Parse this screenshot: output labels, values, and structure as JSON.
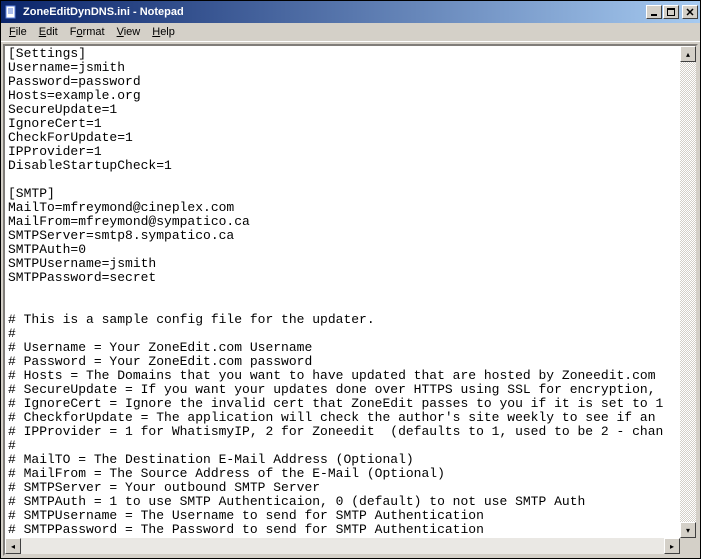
{
  "title": "ZoneEditDynDNS.ini - Notepad",
  "menu": {
    "file": "File",
    "edit": "Edit",
    "format": "Format",
    "view": "View",
    "help": "Help"
  },
  "content": "[Settings]\nUsername=jsmith\nPassword=password\nHosts=example.org\nSecureUpdate=1\nIgnoreCert=1\nCheckForUpdate=1\nIPProvider=1\nDisableStartupCheck=1\n\n[SMTP]\nMailTo=mfreymond@cineplex.com\nMailFrom=mfreymond@sympatico.ca\nSMTPServer=smtp8.sympatico.ca\nSMTPAuth=0\nSMTPUsername=jsmith\nSMTPPassword=secret\n\n\n# This is a sample config file for the updater.\n#\n# Username = Your ZoneEdit.com Username\n# Password = Your ZoneEdit.com password\n# Hosts = The Domains that you want to have updated that are hosted by Zoneedit.com\n# SecureUpdate = If you want your updates done over HTTPS using SSL for encryption,\n# IgnoreCert = Ignore the invalid cert that ZoneEdit passes to you if it is set to 1\n# CheckforUpdate = The application will check the author's site weekly to see if an\n# IPProvider = 1 for WhatismyIP, 2 for Zoneedit  (defaults to 1, used to be 2 - chan\n#\n# MailTO = The Destination E-Mail Address (Optional)\n# MailFrom = The Source Address of the E-Mail (Optional)\n# SMTPServer = Your outbound SMTP Server\n# SMTPAuth = 1 to use SMTP Authenticaion, 0 (default) to not use SMTP Auth\n# SMTPUsername = The Username to send for SMTP Authentication\n# SMTPPassword = The Password to send for SMTP Authentication\n#"
}
